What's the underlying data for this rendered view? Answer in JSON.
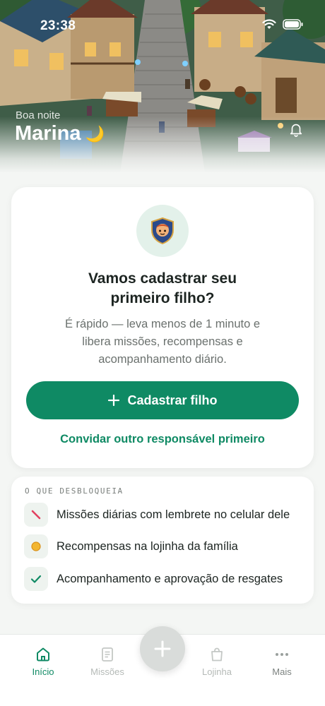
{
  "status_bar": {
    "time": "23:38"
  },
  "header": {
    "greeting": "Boa noite",
    "user_name": "Marina",
    "emoji": "🌙"
  },
  "onboarding": {
    "title": "Vamos cadastrar seu primeiro filho?",
    "description": "É rápido — leva menos de 1 minuto e libera missões, recompensas e acompanhamento diário.",
    "primary_button": "Cadastrar filho",
    "secondary_link": "Convidar outro responsável primeiro"
  },
  "unlocks": {
    "heading": "O QUE DESBLOQUEIA",
    "items": [
      {
        "icon": "pencil-icon",
        "label": "Missões diárias com lembrete no celular dele"
      },
      {
        "icon": "coin-icon",
        "label": "Recompensas na lojinha da família"
      },
      {
        "icon": "check-icon",
        "label": "Acompanhamento e aprovação de resgates"
      }
    ]
  },
  "bottom_nav": {
    "items": [
      {
        "label": "Início",
        "icon": "home-icon",
        "active": true
      },
      {
        "label": "Missões",
        "icon": "document-icon",
        "active": false
      },
      {
        "label": "Lojinha",
        "icon": "shopping-bag-icon",
        "active": false
      },
      {
        "label": "Mais",
        "icon": "more-icon",
        "active": false
      }
    ]
  },
  "colors": {
    "accent": "#0f8a64",
    "accent_light": "#e3f1ea",
    "text_primary": "#1c2421",
    "text_secondary": "#6b716e",
    "background": "#f4f6f4"
  }
}
